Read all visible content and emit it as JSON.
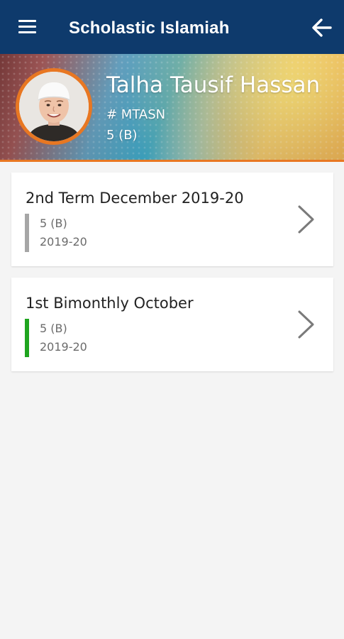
{
  "appbar": {
    "title": "Scholastic Islamiah",
    "menu_icon": "hamburger-menu-icon",
    "back_icon": "arrow-left-icon",
    "background_color": "#0e3a6c"
  },
  "profile": {
    "name": "Talha Tausif Hassan",
    "id": "# MTASN",
    "class": "5 (B)",
    "accent_color": "#e87722"
  },
  "exams": [
    {
      "title": "2nd Term December 2019-20",
      "class": "5 (B)",
      "year": "2019-20",
      "status_color": "#a6a6a6",
      "chevron_icon": "chevron-right-icon"
    },
    {
      "title": "1st Bimonthly October",
      "class": "5 (B)",
      "year": "2019-20",
      "status_color": "#1fa51f",
      "chevron_icon": "chevron-right-icon"
    }
  ]
}
